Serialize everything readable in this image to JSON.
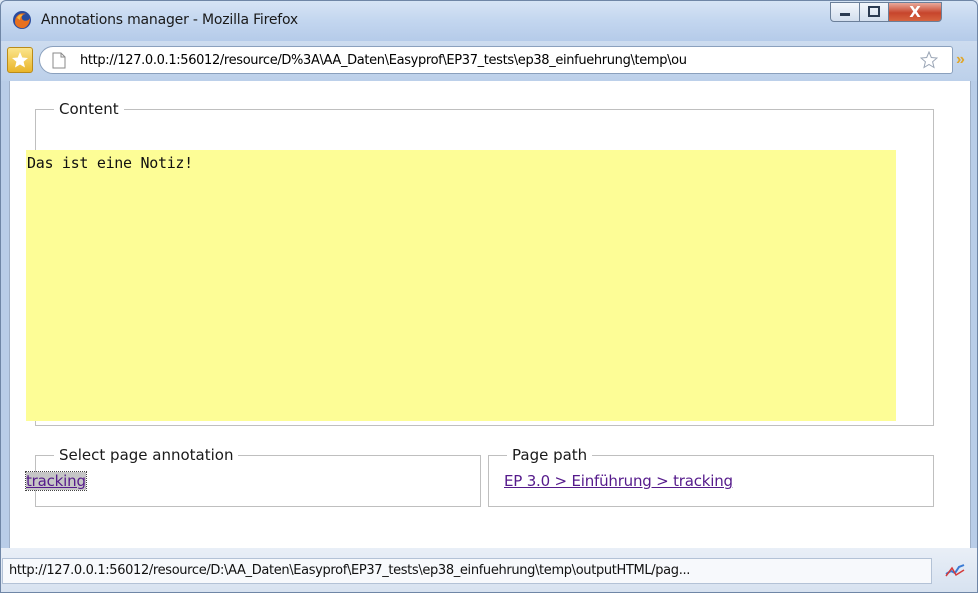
{
  "window": {
    "title": "Annotations manager - Mozilla Firefox",
    "controls": {
      "minimize": "minimize",
      "maximize": "maximize",
      "close": "X"
    }
  },
  "urlbar": {
    "url": "http://127.0.0.1:56012/resource/D%3A\\AA_Daten\\Easyprof\\EP37_tests\\ep38_einfuehrung\\temp\\ou"
  },
  "content": {
    "legend": "Content",
    "note_text": "Das ist eine Notiz!",
    "note_color": "#fdfd96"
  },
  "select_annotation": {
    "legend": "Select page annotation",
    "link": "tracking"
  },
  "page_path": {
    "legend": "Page path",
    "link": "EP 3.0 > Einführung > tracking"
  },
  "statusbar": {
    "text": "http://127.0.0.1:56012/resource/D:\\AA_Daten\\Easyprof\\EP37_tests\\ep38_einfuehrung\\temp\\outputHTML/pag..."
  },
  "colors": {
    "link": "#551a8b",
    "close_button": "#c7452c"
  }
}
